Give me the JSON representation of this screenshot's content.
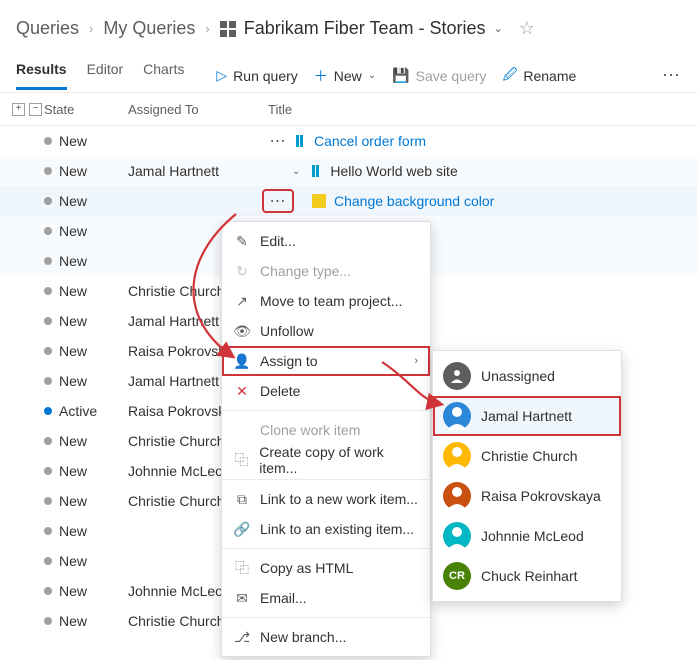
{
  "breadcrumb": {
    "level1": "Queries",
    "level2": "My Queries",
    "current": "Fabrikam Fiber Team - Stories"
  },
  "tabs": {
    "results": "Results",
    "editor": "Editor",
    "charts": "Charts"
  },
  "toolbar": {
    "run": "Run query",
    "nu": "New",
    "save": "Save query",
    "rename": "Rename"
  },
  "columns": {
    "state": "State",
    "assigned": "Assigned To",
    "title": "Title"
  },
  "rows": [
    {
      "state": "New",
      "stateType": "new",
      "assigned": "",
      "titleType": "story",
      "title": "Cancel order form",
      "link": true,
      "indent": 0,
      "showMore": true,
      "exp": false,
      "sel": ""
    },
    {
      "state": "New",
      "stateType": "new",
      "assigned": "Jamal Hartnett",
      "titleType": "story",
      "title": "Hello World web site",
      "link": false,
      "indent": 0,
      "showMore": false,
      "exp": true,
      "sel": "r"
    },
    {
      "state": "New",
      "stateType": "new",
      "assigned": "",
      "titleType": "task",
      "title": "Change background color",
      "link": true,
      "indent": 1,
      "showMore": true,
      "exp": false,
      "sel": "s",
      "hlMore": true
    },
    {
      "state": "New",
      "stateType": "new",
      "assigned": "",
      "titleType": "none",
      "title": "",
      "link": false,
      "indent": 0,
      "showMore": false,
      "exp": false,
      "sel": "r"
    },
    {
      "state": "New",
      "stateType": "new",
      "assigned": "",
      "titleType": "none",
      "title": "",
      "link": false,
      "indent": 0,
      "showMore": false,
      "exp": false,
      "sel": "r"
    },
    {
      "state": "New",
      "stateType": "new",
      "assigned": "Christie Church",
      "titleType": "none",
      "title": "",
      "link": false,
      "indent": 0,
      "showMore": false,
      "exp": false,
      "sel": ""
    },
    {
      "state": "New",
      "stateType": "new",
      "assigned": "Jamal Hartnett",
      "titleType": "none",
      "title": "",
      "link": false,
      "indent": 0,
      "showMore": false,
      "exp": false,
      "sel": ""
    },
    {
      "state": "New",
      "stateType": "new",
      "assigned": "Raisa Pokrovska",
      "titleType": "none",
      "title": "",
      "link": false,
      "indent": 0,
      "showMore": false,
      "exp": false,
      "sel": ""
    },
    {
      "state": "New",
      "stateType": "new",
      "assigned": "Jamal Hartnett",
      "titleType": "none",
      "title": "",
      "link": false,
      "indent": 0,
      "showMore": false,
      "exp": false,
      "sel": ""
    },
    {
      "state": "Active",
      "stateType": "active",
      "assigned": "Raisa Pokrovska",
      "titleType": "none",
      "title": "",
      "link": false,
      "indent": 0,
      "showMore": false,
      "exp": false,
      "sel": ""
    },
    {
      "state": "New",
      "stateType": "new",
      "assigned": "Christie Church",
      "titleType": "none",
      "title": "",
      "link": false,
      "indent": 0,
      "showMore": false,
      "exp": false,
      "sel": ""
    },
    {
      "state": "New",
      "stateType": "new",
      "assigned": "Johnnie McLeod",
      "titleType": "none",
      "title": "",
      "link": false,
      "indent": 0,
      "showMore": false,
      "exp": false,
      "sel": ""
    },
    {
      "state": "New",
      "stateType": "new",
      "assigned": "Christie Church",
      "titleType": "none",
      "title": "",
      "link": false,
      "indent": 0,
      "showMore": false,
      "exp": false,
      "sel": ""
    },
    {
      "state": "New",
      "stateType": "new",
      "assigned": "",
      "titleType": "none",
      "title": "",
      "link": false,
      "indent": 0,
      "showMore": false,
      "exp": false,
      "sel": ""
    },
    {
      "state": "New",
      "stateType": "new",
      "assigned": "",
      "titleType": "none",
      "title": "",
      "link": false,
      "indent": 0,
      "showMore": false,
      "exp": false,
      "sel": ""
    },
    {
      "state": "New",
      "stateType": "new",
      "assigned": "Johnnie McLeod",
      "titleType": "none",
      "title": "",
      "link": false,
      "indent": 0,
      "showMore": false,
      "exp": false,
      "sel": ""
    },
    {
      "state": "New",
      "stateType": "new",
      "assigned": "Christie Church",
      "titleType": "none",
      "title": "",
      "link": false,
      "indent": 0,
      "showMore": false,
      "exp": false,
      "sel": ""
    }
  ],
  "menu": {
    "edit": "Edit...",
    "changeType": "Change type...",
    "move": "Move to team project...",
    "unfollow": "Unfollow",
    "assignTo": "Assign to",
    "delete": "Delete",
    "clone": "Clone work item",
    "copyOf": "Create copy of work item...",
    "linkNew": "Link to a new work item...",
    "linkExisting": "Link to an existing item...",
    "copyHtml": "Copy as HTML",
    "email": "Email...",
    "branch": "New branch..."
  },
  "submenu": [
    {
      "k": "un",
      "name": "Unassigned",
      "av": "av-un"
    },
    {
      "k": "jh",
      "name": "Jamal Hartnett",
      "av": "av-jh",
      "hover": true
    },
    {
      "k": "cc",
      "name": "Christie Church",
      "av": "av-cc"
    },
    {
      "k": "rp",
      "name": "Raisa Pokrovskaya",
      "av": "av-rp"
    },
    {
      "k": "jm",
      "name": "Johnnie McLeod",
      "av": "av-jm"
    },
    {
      "k": "cr",
      "name": "Chuck Reinhart",
      "av": "av-cr",
      "initials": "CR"
    }
  ]
}
